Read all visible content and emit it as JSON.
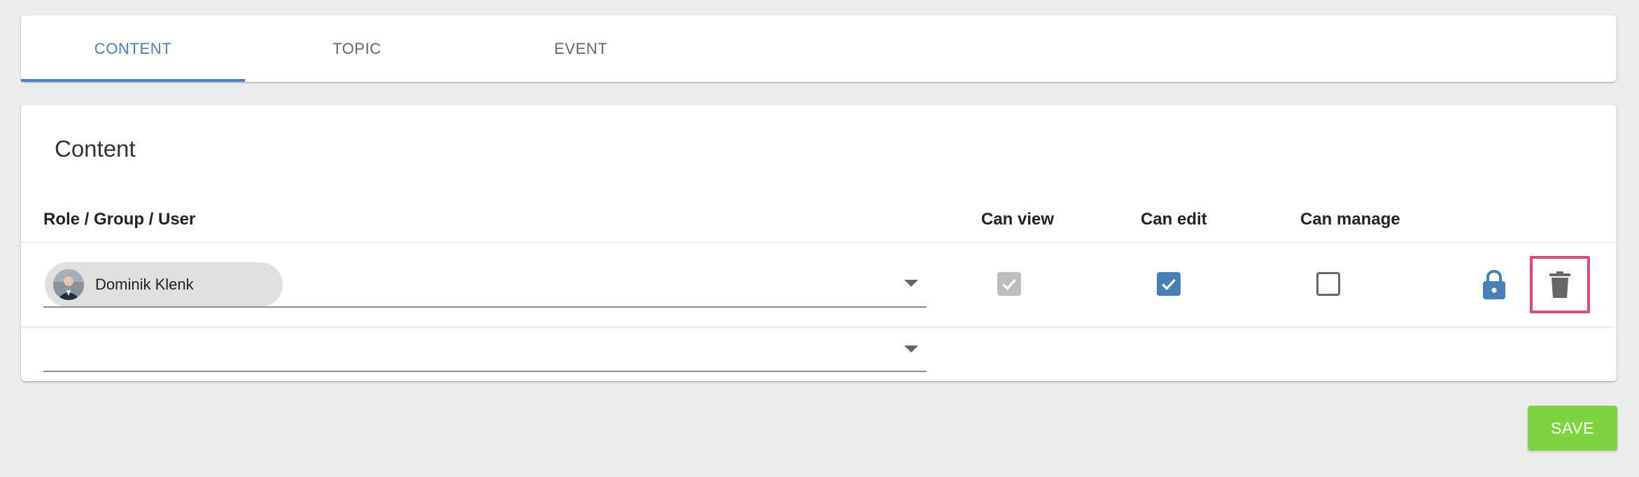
{
  "tabs": [
    {
      "label": "CONTENT",
      "active": true
    },
    {
      "label": "TOPIC",
      "active": false
    },
    {
      "label": "EVENT",
      "active": false
    }
  ],
  "colors": {
    "accent": "#4a7fb8",
    "highlight": "#d94a74",
    "save": "#7ed440"
  },
  "panel": {
    "title": "Content",
    "columns": {
      "principal": "Role / Group / User",
      "can_view": "Can view",
      "can_edit": "Can edit",
      "can_manage": "Can manage"
    },
    "rows": [
      {
        "user": "Dominik Klenk",
        "avatar_icon": "user-photo",
        "can_view": {
          "checked": true,
          "disabled": true
        },
        "can_edit": {
          "checked": true,
          "disabled": false
        },
        "can_manage": {
          "checked": false,
          "disabled": false
        },
        "lock_icon": "lock-icon",
        "delete_icon": "trash-icon"
      }
    ],
    "empty_row": {
      "value": ""
    }
  },
  "actions": {
    "save_label": "SAVE"
  }
}
